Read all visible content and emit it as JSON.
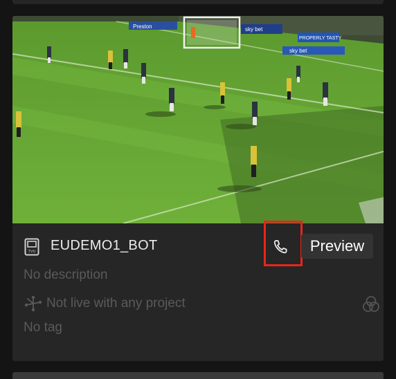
{
  "device": {
    "name": "EUDEMO1_BOT",
    "description": "No description",
    "project_status": "Not live with any project",
    "tag": "No tag",
    "preview_label": "Preview",
    "device_icon": "tvu-device-icon",
    "call_icon": "phone-icon",
    "project_icon": "network-nodes-icon",
    "color_icon": "color-circles-icon"
  },
  "thumbnail": {
    "billboards": [
      "Preston",
      "sky bet",
      "PROPERLY TASTY",
      "sky bet"
    ]
  },
  "colors": {
    "card_bg": "#262626",
    "page_bg": "#141414",
    "highlight": "#e8251a",
    "muted_text": "#5a5a5a",
    "primary_text": "#ececec",
    "button_bg": "#333333"
  }
}
